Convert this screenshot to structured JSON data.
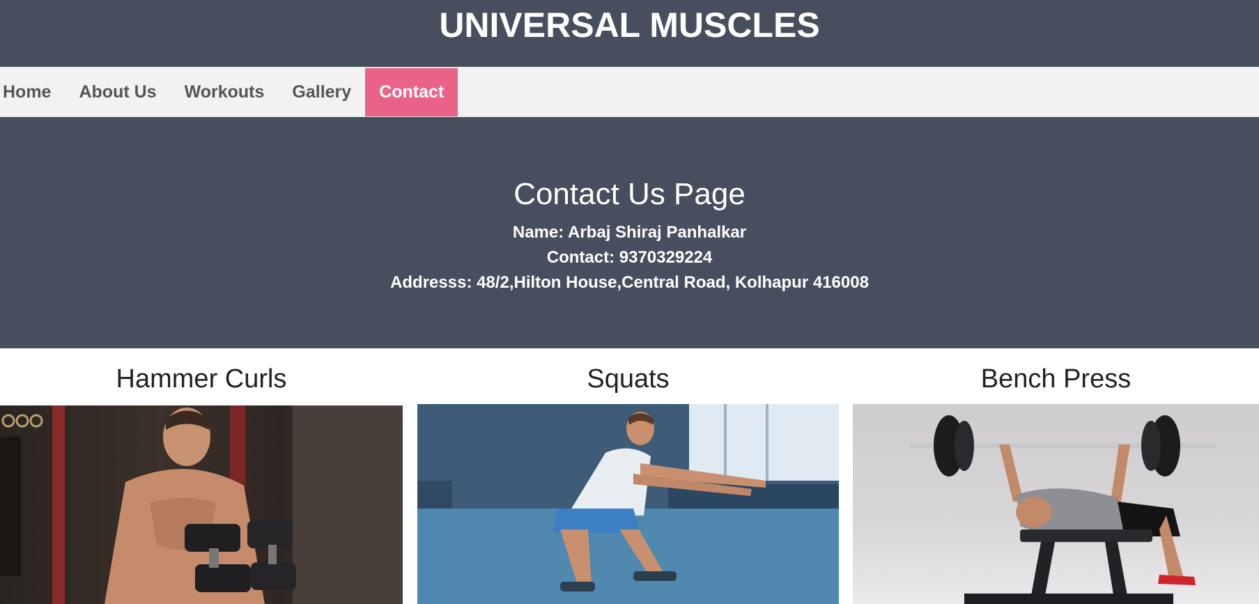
{
  "header": {
    "title": "UNIVERSAL MUSCLES"
  },
  "nav": {
    "items": [
      {
        "label": "Home"
      },
      {
        "label": "About Us"
      },
      {
        "label": "Workouts"
      },
      {
        "label": "Gallery"
      },
      {
        "label": "Contact",
        "active": true
      }
    ]
  },
  "contact": {
    "title": "Contact Us Page",
    "name": "Name: Arbaj Shiraj Panhalkar",
    "phone": "Contact: 9370329224",
    "address": "Addresss: 48/2,Hilton House,Central Road, Kolhapur 416008"
  },
  "workouts": [
    {
      "title": "Hammer Curls",
      "image": "man-with-dumbbells-photo"
    },
    {
      "title": "Squats",
      "image": "man-squatting-photo"
    },
    {
      "title": "Bench Press",
      "image": "man-bench-pressing-photo"
    }
  ],
  "colors": {
    "header_bg": "#474e5d",
    "nav_bg": "#f2f2f2",
    "active_tab": "#ea6287",
    "nav_text": "#555555"
  }
}
